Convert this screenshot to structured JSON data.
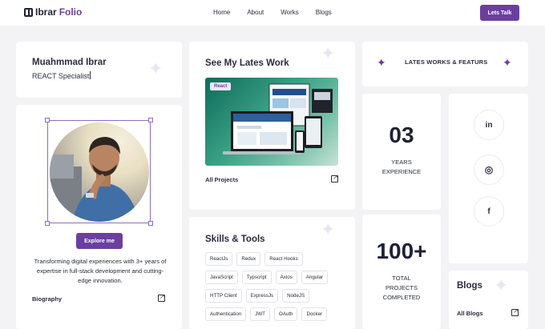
{
  "nav": {
    "logo_part1": "Ibrar",
    "logo_part2": "Folio",
    "links": [
      "Home",
      "About",
      "Works",
      "Blogs"
    ],
    "cta_label": "Lets Talk"
  },
  "intro": {
    "name": "Muahmmad Ibrar",
    "role": "REACT Specialist"
  },
  "profile": {
    "explore_label": "Explore me",
    "bio": "Transforming digital experiences with 3+ years of expertise in full-stack development and cutting-edge innovation.",
    "link_label": "Biography"
  },
  "work": {
    "title": "See My Lates Work",
    "tag": "React",
    "link_label": "All Projects"
  },
  "skills": {
    "title": "Skills & Tools",
    "items": [
      "ReactJs",
      "Redux",
      "React Hooks",
      "JavaScript",
      "Typscript",
      "Axios",
      "Angular",
      "HTTP Client",
      "ExpressJs",
      "NodeJS",
      "Authentication",
      "JWT",
      "OAuth",
      "Docker"
    ]
  },
  "featured": {
    "label": "LATES WORKS & FEATURS"
  },
  "stats": {
    "years_value": "03",
    "years_label_1": "YEARS",
    "years_label_2": "EXPERIENCE",
    "projects_value": "100+",
    "projects_label_1": "TOTAL",
    "projects_label_2": "PROJECTS",
    "projects_label_3": "COMPLETED"
  },
  "social": {
    "linkedin": "in",
    "dribbble": "◎",
    "facebook": "f"
  },
  "blogs": {
    "title": "Blogs",
    "link_label": "All Blogs"
  },
  "colors": {
    "accent": "#6b3fa0",
    "background": "#f3f3f5",
    "card": "#ffffff"
  }
}
